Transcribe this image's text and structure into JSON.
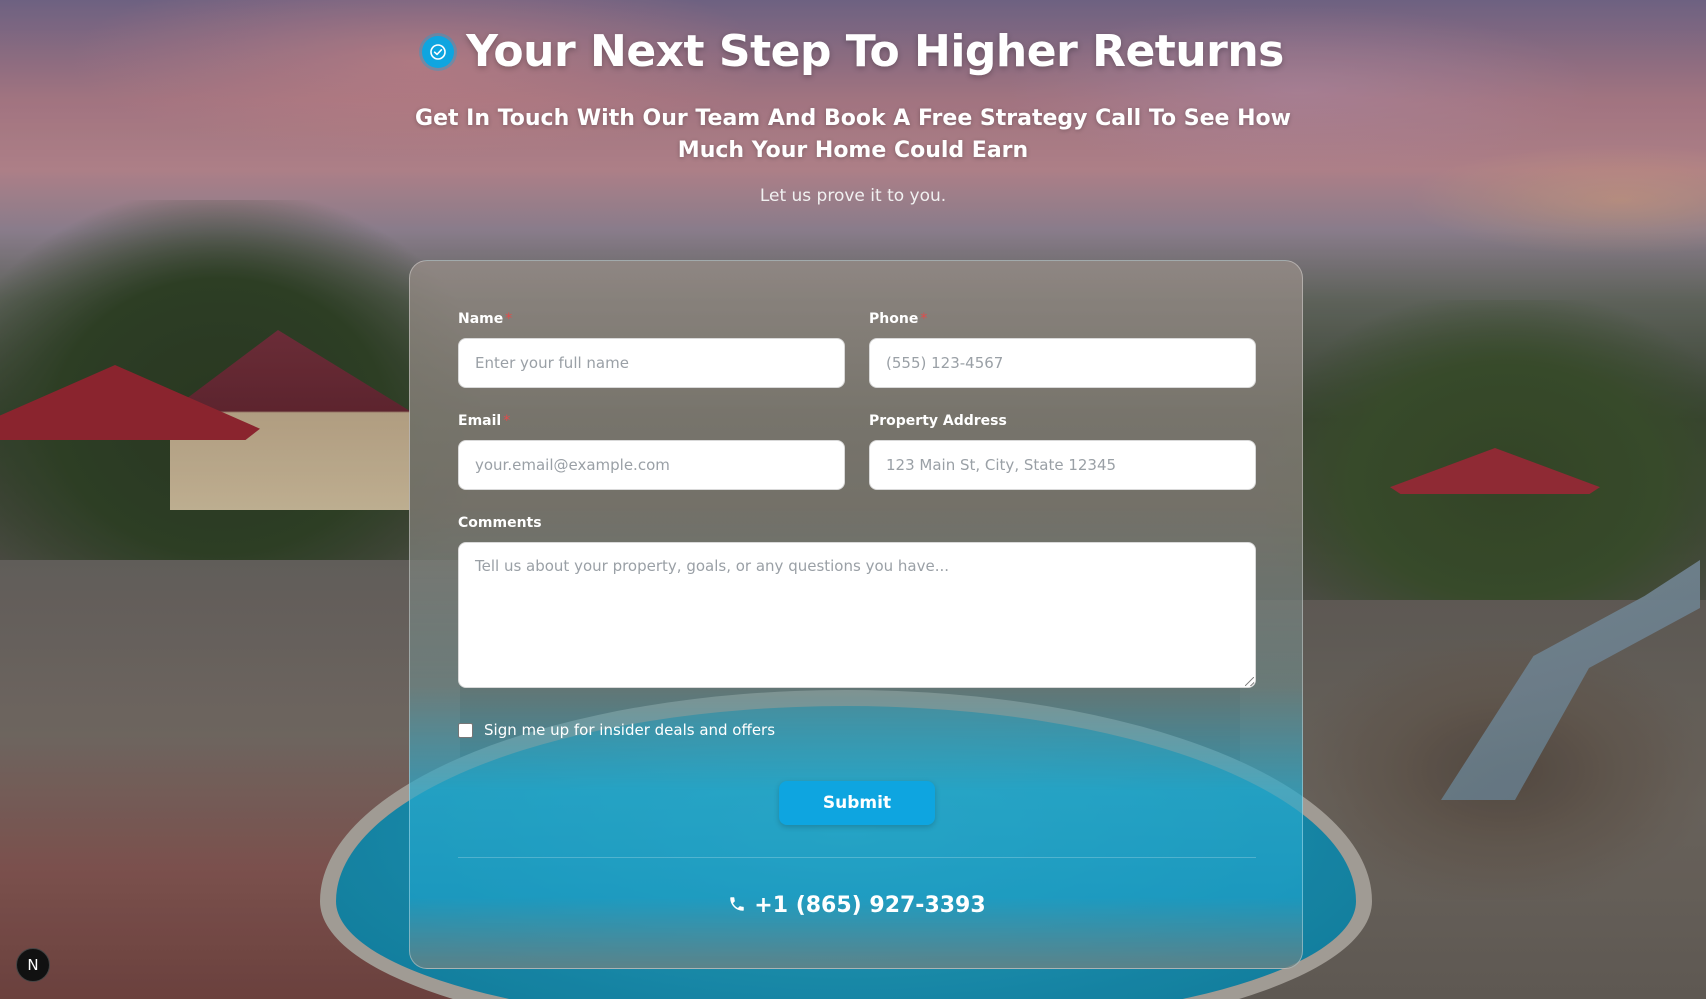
{
  "hero": {
    "title": "Your Next Step To Higher Returns",
    "subtitle": "Get In Touch With Our Team And Book A Free Strategy Call To See How Much Your Home Could Earn",
    "tagline": "Let us prove it to you.",
    "badge_icon": "check-circle-icon"
  },
  "form": {
    "name": {
      "label": "Name",
      "required_mark": "*",
      "placeholder": "Enter your full name"
    },
    "phone": {
      "label": "Phone",
      "required_mark": "*",
      "placeholder": "(555) 123-4567"
    },
    "email": {
      "label": "Email",
      "required_mark": "*",
      "placeholder": "your.email@example.com"
    },
    "address": {
      "label": "Property Address",
      "placeholder": "123 Main St, City, State 12345"
    },
    "comments": {
      "label": "Comments",
      "placeholder": "Tell us about your property, goals, or any questions you have..."
    },
    "newsletter": {
      "label": "Sign me up for insider deals and offers",
      "checked": false
    },
    "submit_label": "Submit"
  },
  "contact": {
    "phone_number": "+1 (865) 927-3393",
    "icon": "phone-icon"
  },
  "dev_badge": {
    "letter": "N"
  },
  "colors": {
    "accent": "#0ea5e0",
    "required": "#e24b4b"
  }
}
